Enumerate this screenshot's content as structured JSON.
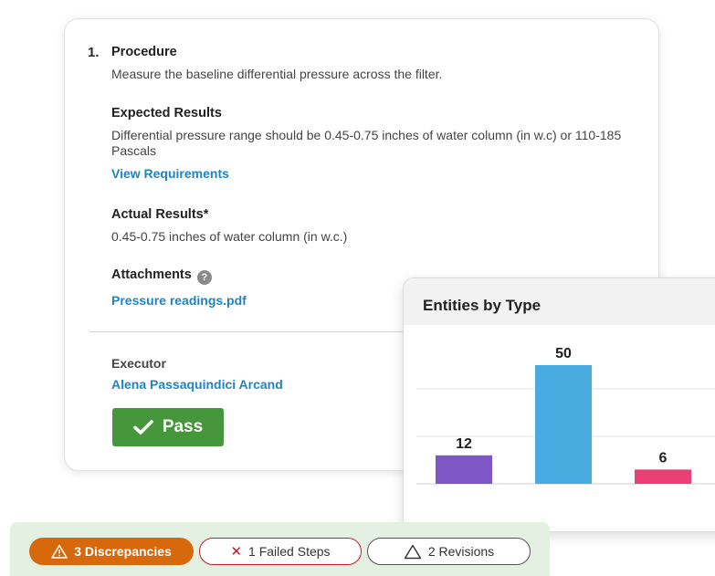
{
  "step": {
    "number": "1.",
    "procedure_heading": "Procedure",
    "procedure_text": "Measure the baseline differential pressure across the filter.",
    "expected_heading": "Expected Results",
    "expected_text": "Differential pressure range should be 0.45-0.75 inches of water column (in w.c) or 110-185 Pascals",
    "view_requirements": "View Requirements",
    "actual_heading": "Actual Results*",
    "actual_text": "0.45-0.75 inches of water column (in w.c.)",
    "attachments_heading": "Attachments",
    "help_icon": "question-circle-icon",
    "attachment_file": "Pressure readings.pdf",
    "executor_label": "Executor",
    "executor_name": "Alena Passaquindici Arcand",
    "pass_label": "Pass"
  },
  "chart_panel": {
    "title": "Entities by Type"
  },
  "chart_data": {
    "type": "bar",
    "title": "Entities by Type",
    "categories": [
      "",
      "",
      ""
    ],
    "values": [
      12,
      50,
      6
    ],
    "colors": [
      "#7f56c5",
      "#4aabe0",
      "#ea3f72"
    ],
    "ylim": [
      0,
      60
    ],
    "grid": true,
    "data_labels": true
  },
  "summary": {
    "discrepancies": "3 Discrepancies",
    "failed_steps": "1 Failed Steps",
    "revisions": "2 Revisions"
  },
  "colors": {
    "link": "#1f84c4",
    "pass": "#46973b",
    "discrepancy": "#d8680c",
    "failed": "#c32026",
    "summary_bg": "#e4f1e2"
  }
}
